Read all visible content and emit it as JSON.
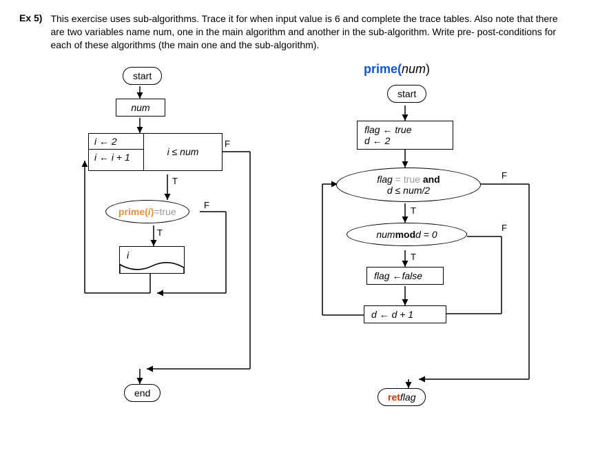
{
  "exercise_label": "Ex 5)",
  "problem_text": "This exercise uses sub-algorithms. Trace it for when input value is 6 and complete the trace tables. Also note that there are two variables name num, one in the main algorithm and another in the sub-algorithm. Write pre- post-conditions for each of these algorithms (the main one and the sub-algorithm).",
  "main": {
    "start": "start",
    "num": "num",
    "loop_init": "i ← 2",
    "loop_step": "i ← i + 1",
    "loop_cond": "i ≤ num",
    "call_prime_fn": "prime(",
    "call_prime_arg": "i",
    "call_prime_close": ")",
    "call_eq": " = ",
    "call_true": "true",
    "output_i": "i",
    "end": "end",
    "T": "T",
    "F": "F"
  },
  "sub": {
    "title_fn": "prime(",
    "title_arg": "num",
    "title_close": ")",
    "start": "start",
    "init_flag": "flag ← true",
    "init_d": "d ← 2",
    "cond_flag": "flag",
    "cond_eq": " = ",
    "cond_true": "true",
    "cond_and": " and",
    "cond_d": "d ≤ num/2",
    "mod_left": "num ",
    "mod_op": "mod",
    "mod_right": " d = 0",
    "set_false": "flag ←false",
    "inc_d": "d ← d + 1",
    "ret": "ret",
    "ret_var": " flag",
    "T": "T",
    "F": "F"
  }
}
